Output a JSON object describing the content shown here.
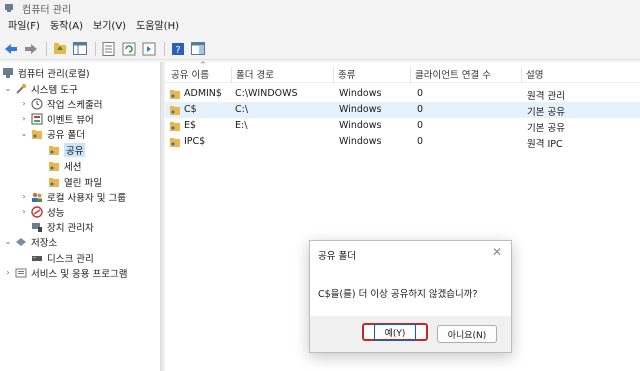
{
  "window": {
    "title": "컴퓨터 관리"
  },
  "menubar": {
    "items": [
      "파일(F)",
      "동작(A)",
      "보기(V)",
      "도움말(H)"
    ]
  },
  "tree": {
    "root": "컴퓨터 관리(로컬)",
    "system_tools": "시스템 도구",
    "task_scheduler": "작업 스케줄러",
    "event_viewer": "이벤트 뷰어",
    "shared_folders": "공유 폴더",
    "shares": "공유",
    "sessions": "세션",
    "open_files": "열린 파일",
    "local_users": "로컬 사용자 및 그룹",
    "performance": "성능",
    "device_manager": "장치 관리자",
    "storage": "저장소",
    "disk_management": "디스크 관리",
    "services_apps": "서비스 및 응용 프로그램"
  },
  "list": {
    "columns": [
      "공유 이름",
      "폴더 경로",
      "종류",
      "클라이언트 연결 수",
      "설명"
    ],
    "rows": [
      {
        "name": "ADMIN$",
        "path": "C:\\WINDOWS",
        "type": "Windows",
        "clients": "0",
        "desc": "원격 관리"
      },
      {
        "name": "C$",
        "path": "C:\\",
        "type": "Windows",
        "clients": "0",
        "desc": "기본 공유"
      },
      {
        "name": "E$",
        "path": "E:\\",
        "type": "Windows",
        "clients": "0",
        "desc": "기본 공유"
      },
      {
        "name": "IPC$",
        "path": "",
        "type": "Windows",
        "clients": "0",
        "desc": "원격 IPC"
      }
    ]
  },
  "dialog": {
    "title": "공유 폴더",
    "close": "✕",
    "message": "C$을(를) 더 이상 공유하지 않겠습니까?",
    "yes_label": "예(Y)",
    "no_label": "아니요(N)"
  },
  "colors": {
    "accent": "#0067c0",
    "highlight_box": "#c3282d",
    "selection": "#cce4f7"
  }
}
